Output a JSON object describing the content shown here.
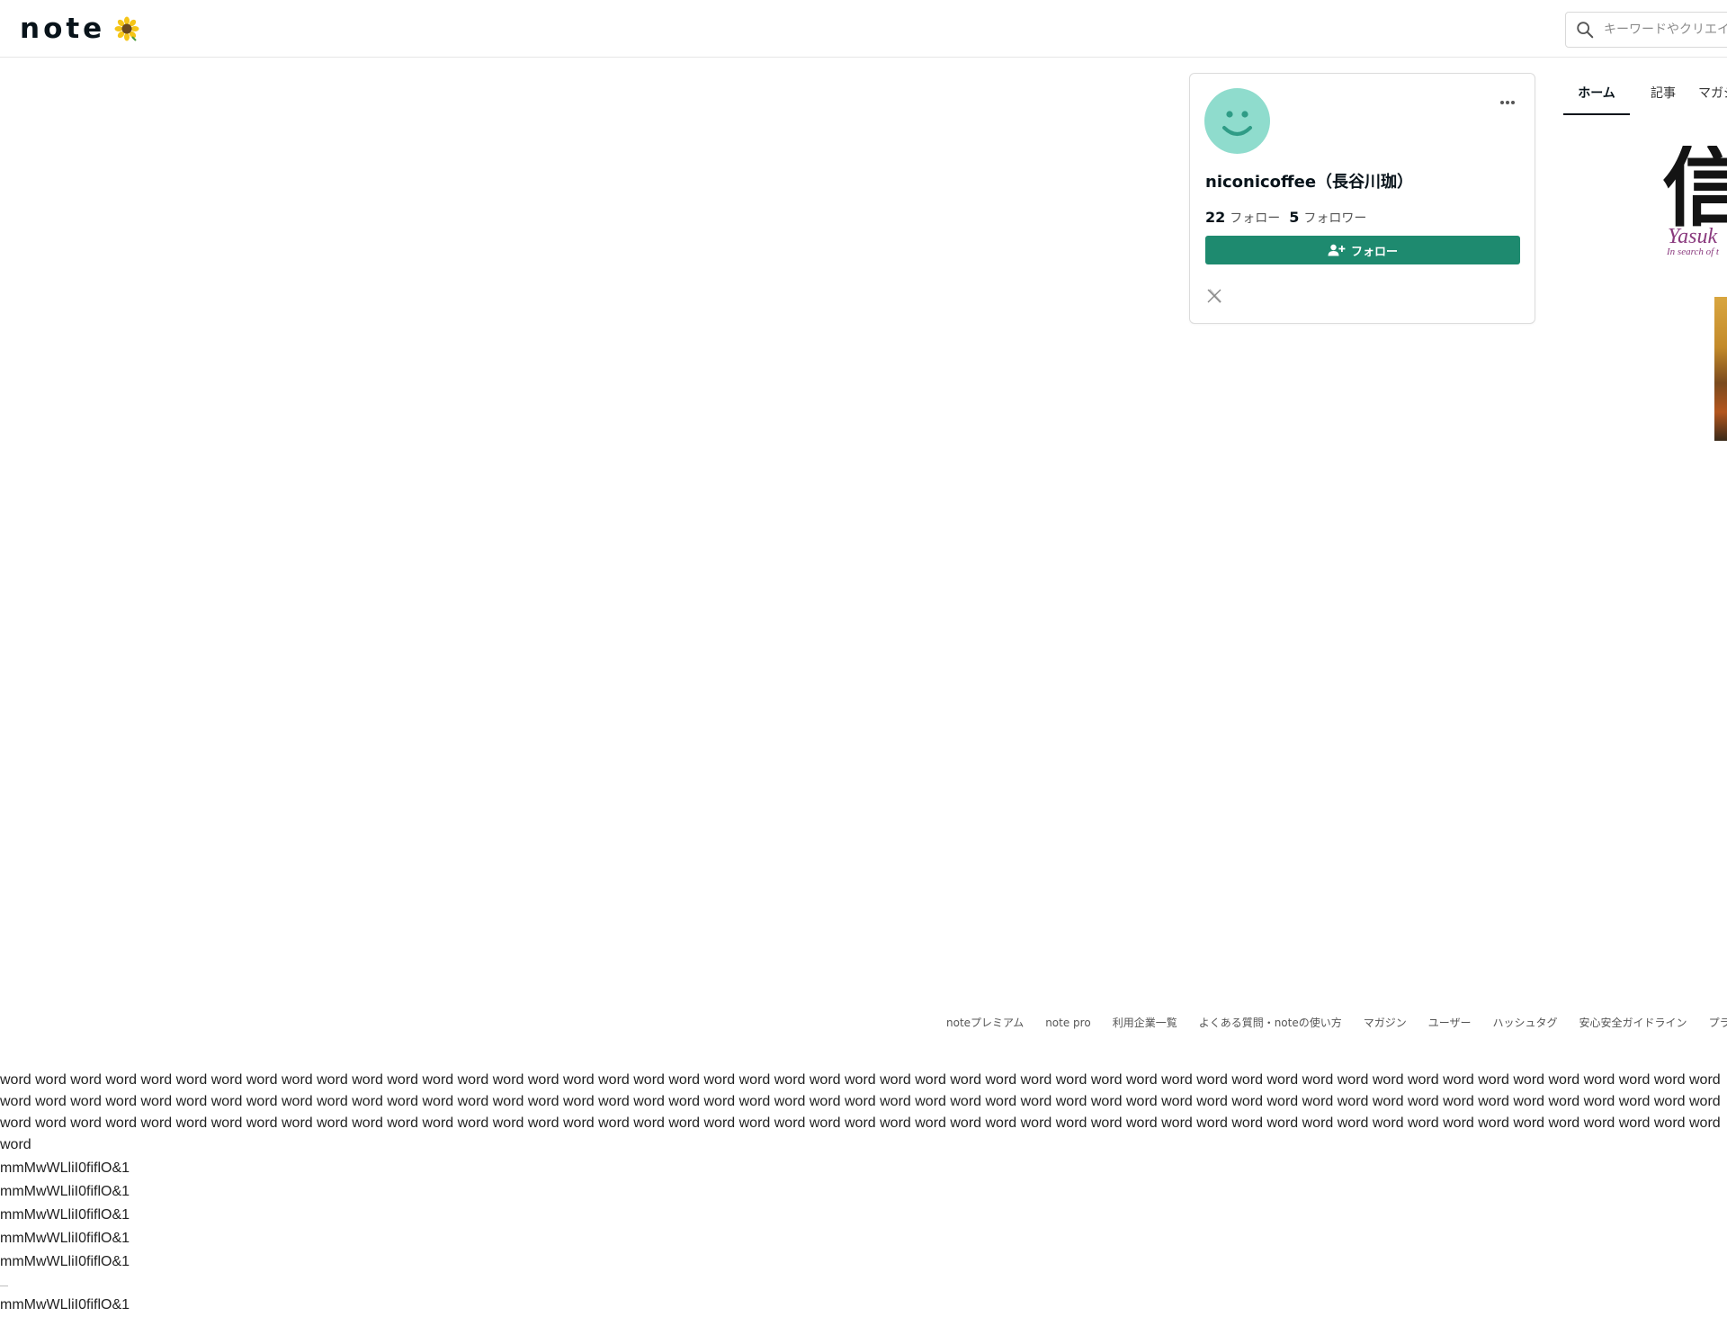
{
  "header": {
    "logo_text": "note",
    "logo_icon": "sunflower-icon",
    "search_placeholder": "キーワードやクリエイターで検索",
    "search_icon": "search-icon"
  },
  "profile": {
    "avatar_icon": "smiley-avatar-icon",
    "avatar_color": "#8fdccd",
    "name": "niconicoffee（長谷川珈）",
    "following_count": "22",
    "following_label": "フォロー",
    "followers_count": "5",
    "followers_label": "フォロワー",
    "follow_button": "フォロー",
    "follow_button_color": "#1e8a6f",
    "social_icon": "x-icon",
    "more_icon": "more-dots-icon"
  },
  "tabs": [
    {
      "label": "ホーム",
      "active": true
    },
    {
      "label": "記事",
      "active": false
    },
    {
      "label": "マガジン",
      "active": false
    }
  ],
  "thumbnail": {
    "kanji": "信",
    "title_fragment": "Yasuk",
    "subtitle_fragment": "In search of t"
  },
  "footer_links": [
    "noteプレミアム",
    "note pro",
    "利用企業一覧",
    "よくある質問・noteの使い方",
    "マガジン",
    "ユーザー",
    "ハッシュタグ",
    "安心安全ガイドライン",
    "プライバシー"
  ],
  "test_block": {
    "word_paragraph": "word word word word word word word word word word word word word word word word word word word word word word word word word word word word word word word word word word word word word word word word word word word word word word word word word word word word word word word word word word word word word word word word word word word word word word word word word word word word word word word word word word word word word word word word word word word word word word word word word word word word word word word word word word word word word word word word word word word word word word word word word word word word word word word word word word word word word word word word word word word word word word word word word word word word",
    "probes": [
      "mmMwWLliI0fiflO&1",
      "mmMwWLliI0fiflO&1",
      "mmMwWLliI0fiflO&1",
      "mmMwWLliI0fiflO&1",
      "mmMwWLliI0fiflO&1"
    ],
    "probe_last": "mmMwWLliI0fiflO&1"
  }
}
